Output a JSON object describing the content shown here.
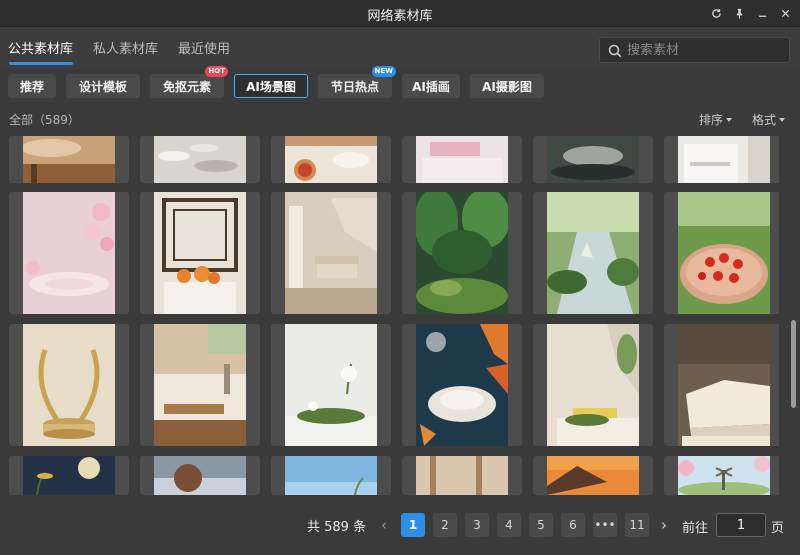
{
  "window": {
    "title": "网络素材库",
    "controls": [
      "refresh-icon",
      "pin-icon",
      "minimize-icon",
      "close-icon"
    ]
  },
  "tabs": [
    {
      "label": "公共素材库",
      "active": true
    },
    {
      "label": "私人素材库",
      "active": false
    },
    {
      "label": "最近使用",
      "active": false
    }
  ],
  "search": {
    "placeholder": "搜索素材",
    "value": ""
  },
  "categories": [
    {
      "label": "推荐",
      "active": false,
      "badge": ""
    },
    {
      "label": "设计模板",
      "active": false,
      "badge": ""
    },
    {
      "label": "免抠元素",
      "active": false,
      "badge": "HOT"
    },
    {
      "label": "AI场景图",
      "active": true,
      "badge": ""
    },
    {
      "label": "节日热点",
      "active": false,
      "badge": "NEW"
    },
    {
      "label": "AI插画",
      "active": false,
      "badge": ""
    },
    {
      "label": "AI摄影图",
      "active": false,
      "badge": ""
    }
  ],
  "filter": {
    "count_label": "全部（589）",
    "sort_label": "排序",
    "format_label": "格式"
  },
  "colors": {
    "accent": "#2f8fe8",
    "active_chip_border": "#46b2f0",
    "hot_badge": "#e9465a",
    "new_badge": "#2f8fe8"
  },
  "thumbnails": [
    {
      "scene": "wooden-table-interior"
    },
    {
      "scene": "water-ripple-surface"
    },
    {
      "scene": "pizza-on-table"
    },
    {
      "scene": "pink-tablecloth"
    },
    {
      "scene": "stones-in-water"
    },
    {
      "scene": "white-cabinet"
    },
    {
      "scene": "cherry-blossom-water"
    },
    {
      "scene": "oranges-chinese-window"
    },
    {
      "scene": "living-room-sofa"
    },
    {
      "scene": "jungle-plants-moss"
    },
    {
      "scene": "forest-stream"
    },
    {
      "scene": "tomatoes-on-plate"
    },
    {
      "scene": "golden-wreath-podium"
    },
    {
      "scene": "bathtub-wooden-tray"
    },
    {
      "scene": "white-rose-moss"
    },
    {
      "scene": "autumn-leaves-pond"
    },
    {
      "scene": "yellow-cheese-podium"
    },
    {
      "scene": "open-books"
    },
    {
      "scene": "moon-night-sky"
    },
    {
      "scene": "sphere-sea"
    },
    {
      "scene": "blue-sky"
    },
    {
      "scene": "beige-room"
    },
    {
      "scene": "sunset-temple-roof"
    },
    {
      "scene": "windmill-cherry-blossom"
    }
  ],
  "pagination": {
    "total_label": "共 589 条",
    "pages": [
      "1",
      "2",
      "3",
      "4",
      "5",
      "6",
      "•••",
      "11"
    ],
    "current_page": "1",
    "goto_label": "前往",
    "goto_value": "1",
    "page_suffix": "页"
  }
}
